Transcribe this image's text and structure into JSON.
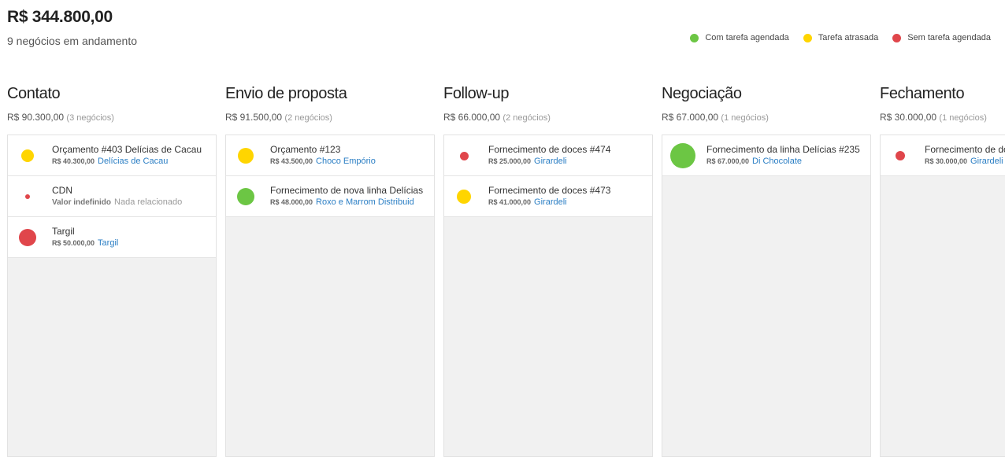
{
  "header": {
    "total": "R$ 344.800,00",
    "subtitle": "9 negócios em andamento"
  },
  "legend": [
    {
      "label": "Com tarefa agendada",
      "color": "#6cc644"
    },
    {
      "label": "Tarefa atrasada",
      "color": "#ffd500"
    },
    {
      "label": "Sem tarefa agendada",
      "color": "#e0464b"
    }
  ],
  "colors": {
    "green": "#6cc644",
    "yellow": "#ffd500",
    "red": "#e0464b",
    "link": "#2a7ec4"
  },
  "columns": [
    {
      "title": "Contato",
      "sum": "R$ 90.300,00",
      "count": "(3 negócios)",
      "cards": [
        {
          "title": "Orçamento #403 Delícias de Cacau",
          "value": "R$ 40.300,00",
          "related": "Delícias de Cacau",
          "status": "yellow"
        },
        {
          "title": "CDN",
          "value": "Valor indefinido",
          "related": "Nada relacionado",
          "status": "red"
        },
        {
          "title": "Targil",
          "value": "R$ 50.000,00",
          "related": "Targil",
          "status": "red"
        }
      ]
    },
    {
      "title": "Envio de proposta",
      "sum": "R$ 91.500,00",
      "count": "(2 negócios)",
      "cards": [
        {
          "title": "Orçamento #123",
          "value": "R$ 43.500,00",
          "related": "Choco Empório",
          "status": "yellow"
        },
        {
          "title": "Fornecimento de nova linha Delícias",
          "value": "R$ 48.000,00",
          "related": "Roxo e Marrom Distribuid",
          "status": "green"
        }
      ]
    },
    {
      "title": "Follow-up",
      "sum": "R$ 66.000,00",
      "count": "(2 negócios)",
      "cards": [
        {
          "title": "Fornecimento de doces #474",
          "value": "R$ 25.000,00",
          "related": "Girardeli",
          "status": "red"
        },
        {
          "title": "Fornecimento de doces #473",
          "value": "R$ 41.000,00",
          "related": "Girardeli",
          "status": "yellow"
        }
      ]
    },
    {
      "title": "Negociação",
      "sum": "R$ 67.000,00",
      "count": "(1 negócios)",
      "cards": [
        {
          "title": "Fornecimento da linha Delícias #235",
          "value": "R$ 67.000,00",
          "related": "Di Chocolate",
          "status": "green"
        }
      ]
    },
    {
      "title": "Fechamento",
      "sum": "R$ 30.000,00",
      "count": "(1 negócios)",
      "cards": [
        {
          "title": "Fornecimento de doces",
          "value": "R$ 30.000,00",
          "related": "Girardeli",
          "status": "red"
        }
      ]
    }
  ]
}
